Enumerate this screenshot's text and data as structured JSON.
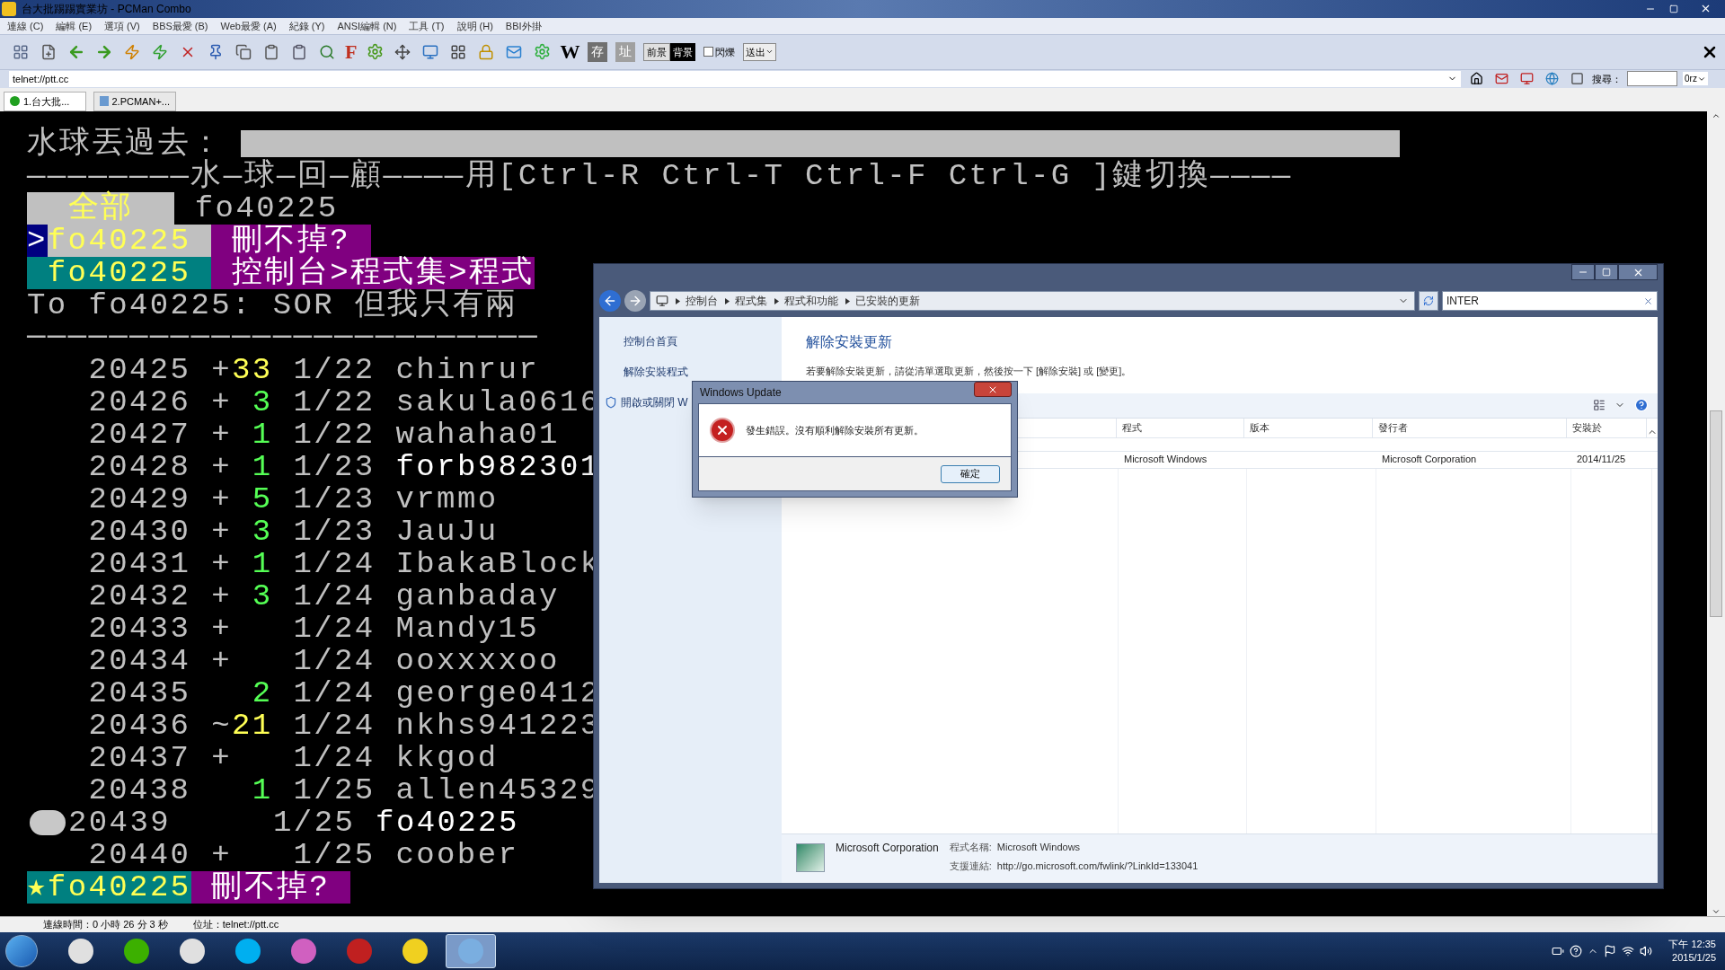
{
  "window": {
    "title": "台大批踢踢實業坊 - PCMan Combo"
  },
  "menu": [
    "連線 (C)",
    "編輯 (E)",
    "選項 (V)",
    "BBS最愛 (B)",
    "Web最愛 (A)",
    "紀錄 (Y)",
    "ANSI編輯 (N)",
    "工具 (T)",
    "說明 (H)",
    "BBI外掛"
  ],
  "toolbar": {
    "font_button": "F",
    "wiki_button": "W",
    "save_button": "存",
    "address_button": "址",
    "fg_button": "前景",
    "bg_button": "背景",
    "blink": {
      "label": "閃爍",
      "checked": false
    },
    "send_button": "送出"
  },
  "address_bar": {
    "value": "telnet://ptt.cc",
    "search_label": "搜尋：",
    "search_engine": "0rz"
  },
  "tabs": [
    {
      "label": "1.台大批...",
      "selected": true
    },
    {
      "label": "2.PCMAN+...",
      "selected": false
    }
  ],
  "terminal": {
    "lines": [
      {
        "segments": [
          {
            "kind": "text",
            "text": "水球丟過去：",
            "color": "#c0c0c0"
          },
          {
            "kind": "input"
          }
        ]
      },
      {
        "segments": [
          {
            "kind": "text",
            "text": "————————水—球—回—顧————用[Ctrl-R Ctrl-T Ctrl-F Ctrl-G ]鍵切換————",
            "color": "#c0c0c0"
          }
        ]
      },
      {
        "segments": [
          {
            "kind": "name_tag",
            "text": "  全部  ",
            "color": "#c0c0c0"
          },
          {
            "kind": "text",
            "text": " fo40225",
            "color": "#c0c0c0"
          }
        ]
      },
      {
        "segments": [
          {
            "kind": "message_tag",
            "text": ">",
            "color": "#000080"
          },
          {
            "kind": "name_tag",
            "text": "fo40225 ",
            "color": "#c0c0c0"
          },
          {
            "kind": "message_tag",
            "text": " 刪不掉? ",
            "color": "#800080"
          }
        ]
      },
      {
        "segments": [
          {
            "kind": "name_tag",
            "text": " fo40225 ",
            "color": "#008080"
          },
          {
            "kind": "message_tag",
            "text": " 控制台>程式集>程式",
            "color": "#800080"
          }
        ]
      },
      {
        "segments": [
          {
            "kind": "text",
            "text": "To fo40225: SOR 但我只有兩",
            "color": "#c0c0c0"
          }
        ]
      },
      {
        "segments": [
          {
            "kind": "text",
            "text": "─────────────────────────",
            "color": "#c0c0c0"
          }
        ]
      },
      {
        "segments": [
          {
            "kind": "text",
            "text": "   20425 +",
            "color": "#c0c0c0"
          },
          {
            "kind": "text",
            "text": "33",
            "color": "#ffff55"
          },
          {
            "kind": "text",
            "text": " 1/22 chinrur",
            "color": "#c0c0c0"
          }
        ]
      },
      {
        "segments": [
          {
            "kind": "text",
            "text": "   20426 + ",
            "color": "#c0c0c0"
          },
          {
            "kind": "text",
            "text": "3",
            "color": "#55ff55"
          },
          {
            "kind": "text",
            "text": " 1/22 sakula0616",
            "color": "#c0c0c0"
          }
        ]
      },
      {
        "segments": [
          {
            "kind": "text",
            "text": "   20427 + ",
            "color": "#c0c0c0"
          },
          {
            "kind": "text",
            "text": "1",
            "color": "#55ff55"
          },
          {
            "kind": "text",
            "text": " 1/22 wahaha01",
            "color": "#c0c0c0"
          }
        ]
      },
      {
        "segments": [
          {
            "kind": "text",
            "text": "   20428 + ",
            "color": "#c0c0c0"
          },
          {
            "kind": "text",
            "text": "1",
            "color": "#55ff55"
          },
          {
            "kind": "text",
            "text": " 1/23 ",
            "color": "#c0c0c0"
          },
          {
            "kind": "text",
            "text": "forb982301",
            "color": "#ffffff"
          }
        ]
      },
      {
        "segments": [
          {
            "kind": "text",
            "text": "   20429 + ",
            "color": "#c0c0c0"
          },
          {
            "kind": "text",
            "text": "5",
            "color": "#55ff55"
          },
          {
            "kind": "text",
            "text": " 1/23 vrmmo",
            "color": "#c0c0c0"
          }
        ]
      },
      {
        "segments": [
          {
            "kind": "text",
            "text": "   20430 + ",
            "color": "#c0c0c0"
          },
          {
            "kind": "text",
            "text": "3",
            "color": "#55ff55"
          },
          {
            "kind": "text",
            "text": " 1/23 JauJu",
            "color": "#c0c0c0"
          }
        ]
      },
      {
        "segments": [
          {
            "kind": "text",
            "text": "   20431 + ",
            "color": "#c0c0c0"
          },
          {
            "kind": "text",
            "text": "1",
            "color": "#55ff55"
          },
          {
            "kind": "text",
            "text": " 1/24 IbakaBlock",
            "color": "#c0c0c0"
          }
        ]
      },
      {
        "segments": [
          {
            "kind": "text",
            "text": "   20432 + ",
            "color": "#c0c0c0"
          },
          {
            "kind": "text",
            "text": "3",
            "color": "#55ff55"
          },
          {
            "kind": "text",
            "text": " 1/24 ganbaday",
            "color": "#c0c0c0"
          }
        ]
      },
      {
        "segments": [
          {
            "kind": "text",
            "text": "   20433 +   1/24 Mandy15",
            "color": "#c0c0c0"
          }
        ]
      },
      {
        "segments": [
          {
            "kind": "text",
            "text": "   20434 +   1/24 ooxxxxoo",
            "color": "#c0c0c0"
          }
        ]
      },
      {
        "segments": [
          {
            "kind": "text",
            "text": "   20435   ",
            "color": "#c0c0c0"
          },
          {
            "kind": "text",
            "text": "2",
            "color": "#55ff55"
          },
          {
            "kind": "text",
            "text": " 1/24 george0412",
            "color": "#c0c0c0"
          }
        ]
      },
      {
        "segments": [
          {
            "kind": "text",
            "text": "   20436 ~",
            "color": "#c0c0c0"
          },
          {
            "kind": "text",
            "text": "21",
            "color": "#ffff55"
          },
          {
            "kind": "text",
            "text": " 1/24 nkhs941223",
            "color": "#c0c0c0"
          }
        ]
      },
      {
        "segments": [
          {
            "kind": "text",
            "text": "   20437 +   1/24 kkgod",
            "color": "#c0c0c0"
          }
        ]
      },
      {
        "segments": [
          {
            "kind": "text",
            "text": "   20438   ",
            "color": "#c0c0c0"
          },
          {
            "kind": "text",
            "text": "1",
            "color": "#55ff55"
          },
          {
            "kind": "text",
            "text": " 1/25 allen45329",
            "color": "#c0c0c0"
          }
        ]
      },
      {
        "segments": [
          {
            "kind": "marker"
          },
          {
            "kind": "text",
            "text": "20439",
            "color": "#c0c0c0"
          },
          {
            "kind": "text",
            "text": "     1/25 ",
            "color": "#c0c0c0"
          },
          {
            "kind": "text",
            "text": "fo40225",
            "color": "#ffffff"
          }
        ]
      },
      {
        "segments": [
          {
            "kind": "text",
            "text": "   20440 +   1/25 coober",
            "color": "#c0c0c0"
          }
        ]
      },
      {
        "segments": [
          {
            "kind": "name_tag",
            "text": "★fo40225",
            "color": "#008080"
          },
          {
            "kind": "message_tag",
            "text": " 刪不掉? ",
            "color": "#800080"
          }
        ]
      }
    ]
  },
  "explorer": {
    "breadcrumb": [
      "控制台",
      "程式集",
      "程式和功能",
      "已安裝的更新"
    ],
    "search_value": "INTER",
    "sidebar": [
      "控制台首頁",
      "解除安裝程式",
      "開啟或關閉 W"
    ],
    "heading": "解除安裝更新",
    "description": "若要解除安裝更新，請從清單選取更新，然後按一下 [解除安裝] 或 [變更]。",
    "columns": [
      "程式",
      "版本",
      "發行者",
      "安裝於"
    ],
    "rows": [
      {
        "cells": [
          "Microsoft Windows",
          "",
          "Microsoft Corporation",
          "2014/11/25"
        ]
      }
    ],
    "details": {
      "publisher": "Microsoft Corporation",
      "name_label": "程式名稱:",
      "name_value": "Microsoft Windows",
      "link_label": "支援連結:",
      "link_value": "http://go.microsoft.com/fwlink/?LinkId=133041"
    }
  },
  "dialog": {
    "title": "Windows Update",
    "message": "發生錯誤。沒有順利解除安裝所有更新。",
    "ok_button": "確定"
  },
  "status_bar": {
    "connection_time": "連線時間：0 小時 26 分 3 秒",
    "address": "位址：telnet://ptt.cc"
  },
  "taskbar": {
    "apps": [
      {
        "selected": false
      },
      {
        "selected": false
      },
      {
        "selected": false
      },
      {
        "selected": false
      },
      {
        "selected": false
      },
      {
        "selected": false
      },
      {
        "selected": false
      },
      {
        "selected": true
      }
    ],
    "time": "下午 12:35",
    "date": "2015/1/25"
  }
}
